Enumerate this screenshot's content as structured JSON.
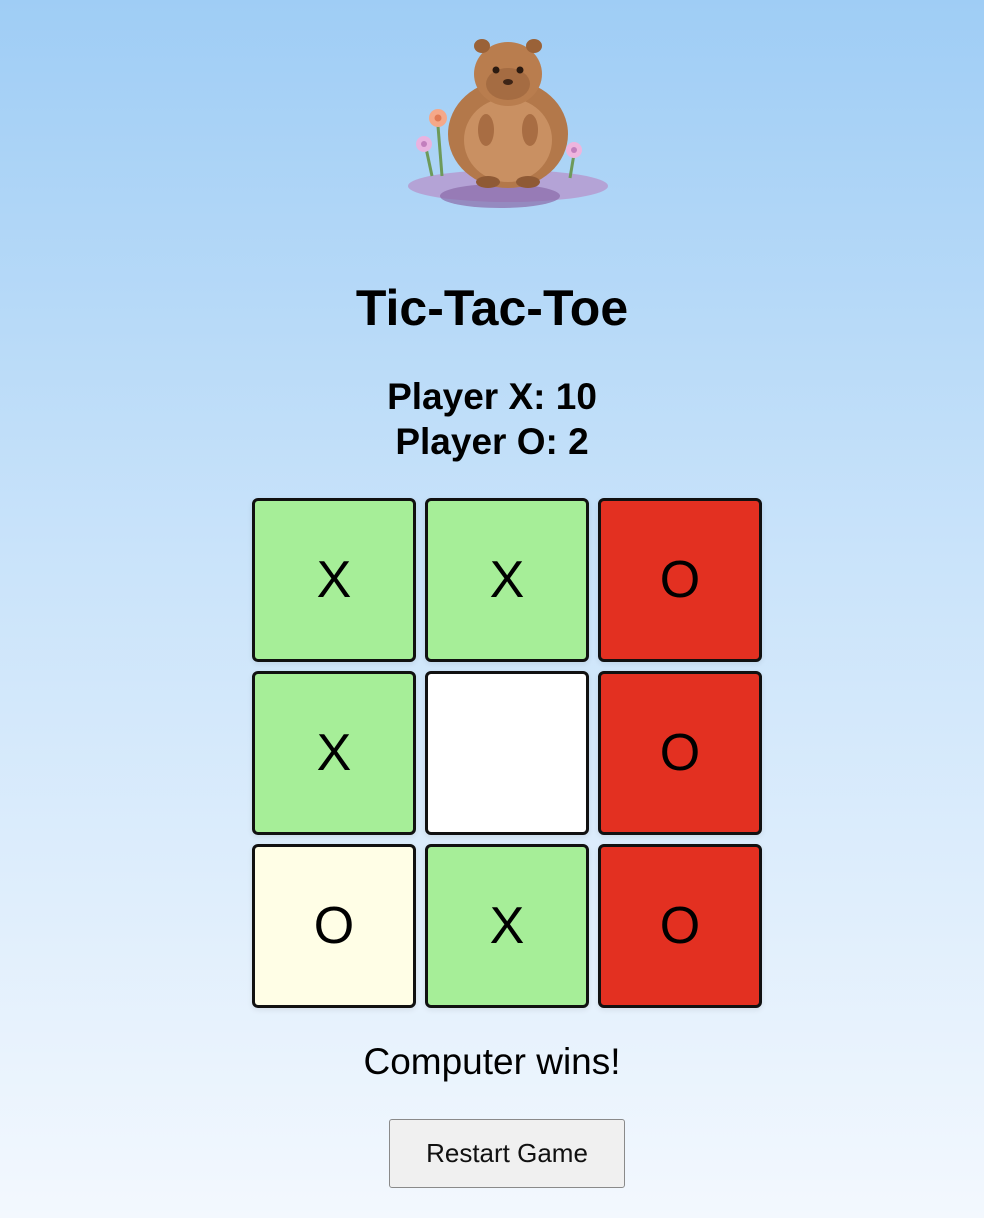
{
  "game": {
    "title": "Tic-Tac-Toe",
    "scores": {
      "x": "Player X: 10",
      "o": "Player O: 2"
    },
    "board": [
      {
        "mark": "X",
        "color": "#a6ee98"
      },
      {
        "mark": "X",
        "color": "#a6ee98"
      },
      {
        "mark": "O",
        "color": "#e33021"
      },
      {
        "mark": "X",
        "color": "#a6ee98"
      },
      {
        "mark": "",
        "color": "#ffffff"
      },
      {
        "mark": "O",
        "color": "#e33021"
      },
      {
        "mark": "O",
        "color": "#fffee6"
      },
      {
        "mark": "X",
        "color": "#a6ee98"
      },
      {
        "mark": "O",
        "color": "#e33021"
      }
    ],
    "status": "Computer wins!",
    "restart_label": "Restart Game"
  },
  "mascot": {
    "icon": "capybara-mascot-icon"
  },
  "colors": {
    "x_cell": "#a6ee98",
    "winning_o_cell": "#e33021",
    "o_cell": "#fffee6",
    "empty_cell": "#ffffff"
  }
}
